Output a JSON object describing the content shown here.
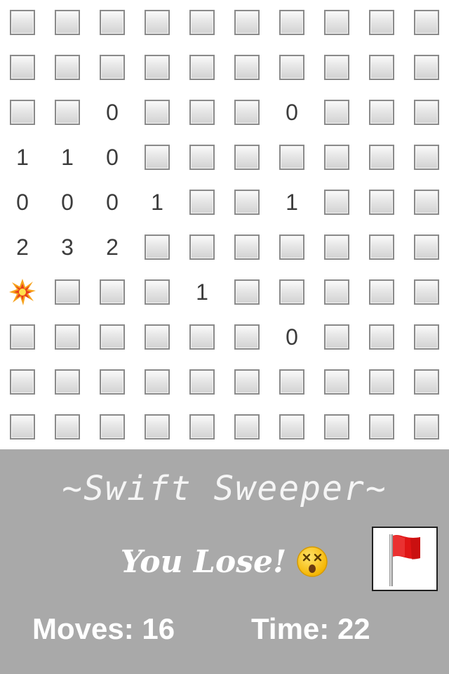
{
  "app": {
    "title": "~Swift Sweeper~",
    "status_text": "You Lose!",
    "status_icon": "dizzy-face-icon",
    "flag_icon": "red-flag-icon",
    "moves_label": "Moves:",
    "moves_value": "16",
    "time_label": "Time:",
    "time_value": "22",
    "panel_color": "#a9a9a9"
  },
  "board": {
    "rows": 10,
    "cols": 10,
    "cells": [
      [
        "h",
        "h",
        "h",
        "h",
        "h",
        "h",
        "h",
        "h",
        "h",
        "h"
      ],
      [
        "h",
        "h",
        "h",
        "h",
        "h",
        "h",
        "h",
        "h",
        "h",
        "h"
      ],
      [
        "h",
        "h",
        "0",
        "h",
        "h",
        "h",
        "0",
        "h",
        "h",
        "h"
      ],
      [
        "1",
        "1",
        "0",
        "h",
        "h",
        "h",
        "h",
        "h",
        "h",
        "h"
      ],
      [
        "0",
        "0",
        "0",
        "1",
        "h",
        "h",
        "1",
        "h",
        "h",
        "h"
      ],
      [
        "2",
        "3",
        "2",
        "h",
        "h",
        "h",
        "h",
        "h",
        "h",
        "h"
      ],
      [
        "boom",
        "h",
        "h",
        "h",
        "1",
        "h",
        "h",
        "h",
        "h",
        "h"
      ],
      [
        "h",
        "h",
        "h",
        "h",
        "h",
        "h",
        "0",
        "h",
        "h",
        "h"
      ],
      [
        "h",
        "h",
        "h",
        "h",
        "h",
        "h",
        "h",
        "h",
        "h",
        "h"
      ],
      [
        "h",
        "h",
        "h",
        "h",
        "h",
        "h",
        "h",
        "h",
        "h",
        "h"
      ]
    ]
  }
}
